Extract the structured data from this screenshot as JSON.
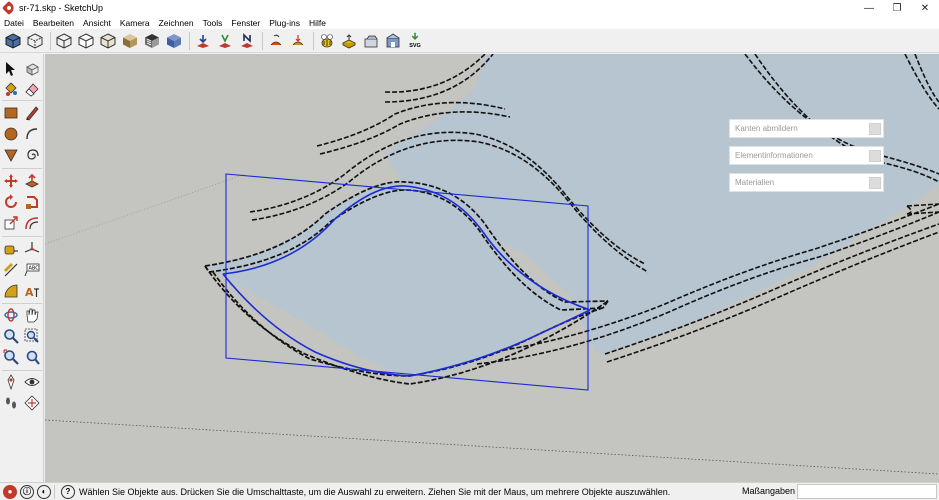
{
  "window": {
    "title": "sr-71.skp - SketchUp",
    "controls": {
      "minimize": "—",
      "restore": "❐",
      "close": "✕"
    }
  },
  "menu": [
    "Datei",
    "Bearbeiten",
    "Ansicht",
    "Kamera",
    "Zeichnen",
    "Tools",
    "Fenster",
    "Plug-ins",
    "Hilfe"
  ],
  "toolbar": {
    "svg_export_label": "SVG"
  },
  "tray_panels": [
    "Kanten abmildern",
    "Elementinformationen",
    "Materialien"
  ],
  "status": {
    "message": "Wählen Sie Objekte aus. Drücken Sie die Umschalttaste, um die Auswahl zu erweitern. Ziehen Sie mit der Maus, um mehrere Objekte auszuwählen.",
    "measurements_label": "Maßangaben",
    "measurements_value": ""
  },
  "colors": {
    "surface": "#b7c5d1",
    "ground": "#c4c4c0",
    "selection": "#1a2bd6",
    "edge": "#111111"
  }
}
